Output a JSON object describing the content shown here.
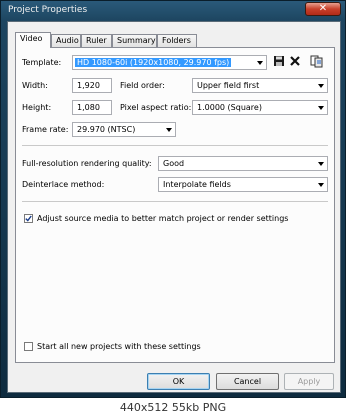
{
  "window": {
    "title": "Project Properties",
    "close_glyph": "✕"
  },
  "tabs": [
    {
      "label": "Video"
    },
    {
      "label": "Audio"
    },
    {
      "label": "Ruler"
    },
    {
      "label": "Summary"
    },
    {
      "label": "Folders"
    }
  ],
  "video": {
    "template_label": "Template:",
    "template_value": "HD 1080-60i (1920x1080, 29.970 fps)",
    "width_label": "Width:",
    "width_value": "1,920",
    "height_label": "Height:",
    "height_value": "1,080",
    "field_order_label": "Field order:",
    "field_order_value": "Upper field first",
    "pixel_aspect_label": "Pixel aspect ratio:",
    "pixel_aspect_value": "1.0000 (Square)",
    "frame_rate_label": "Frame rate:",
    "frame_rate_value": "29.970 (NTSC)",
    "render_quality_label": "Full-resolution rendering quality:",
    "render_quality_value": "Good",
    "deinterlace_label": "Deinterlace method:",
    "deinterlace_value": "Interpolate fields",
    "adjust_source_label": "Adjust source media to better match project or render settings",
    "adjust_source_checked": true,
    "start_all_label": "Start all new projects with these settings",
    "start_all_checked": false
  },
  "icons": {
    "save": "save-icon",
    "delete": "delete-icon",
    "match": "match-media-icon"
  },
  "buttons": {
    "ok": "OK",
    "cancel": "Cancel",
    "apply": "Apply"
  },
  "status": {
    "caption": "440x512 55kb PNG"
  }
}
